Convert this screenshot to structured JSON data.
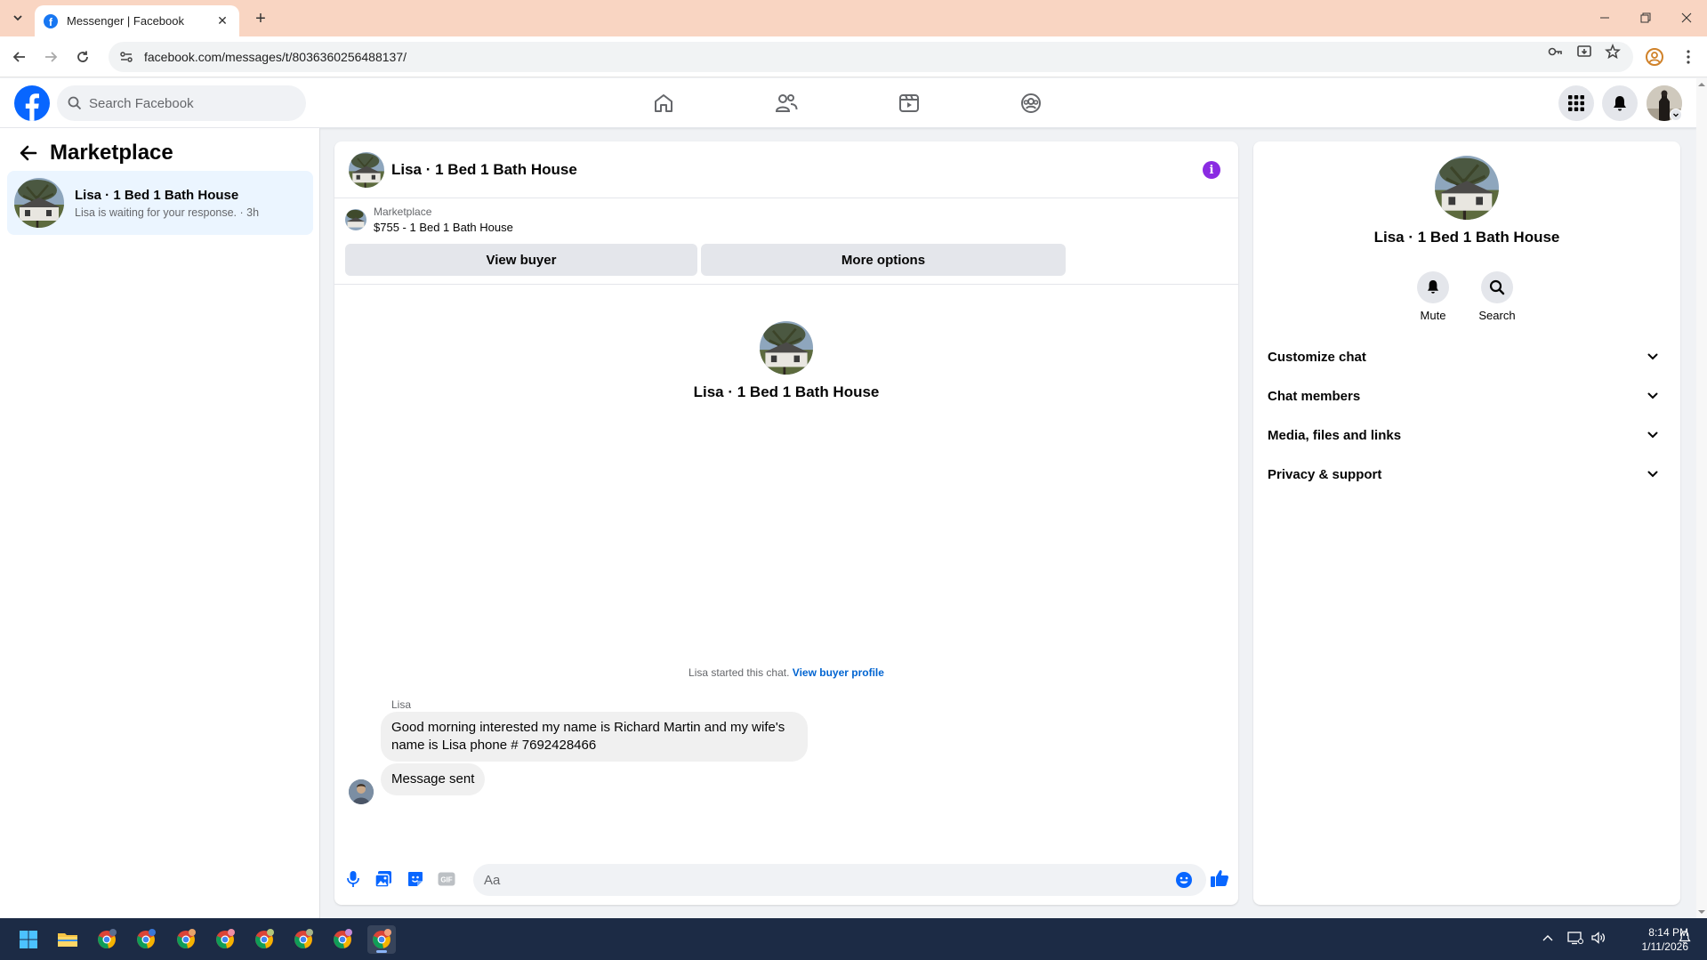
{
  "browser": {
    "tab_title": "Messenger | Facebook",
    "url": "facebook.com/messages/t/8036360256488137/"
  },
  "header": {
    "search_placeholder": "Search Facebook"
  },
  "left_panel": {
    "title": "Marketplace",
    "conversation": {
      "name": "Lisa · 1 Bed 1 Bath House",
      "preview": "Lisa is waiting for your response. · 3h"
    }
  },
  "chat": {
    "header_name": "Lisa · 1 Bed 1 Bath House",
    "marketplace_label": "Marketplace",
    "listing": "$755 - 1 Bed 1 Bath House",
    "view_buyer_label": "View buyer",
    "more_options_label": "More options",
    "profile_name": "Lisa · 1 Bed 1 Bath House",
    "started_text": "Lisa started this chat.",
    "view_buyer_profile_label": "View buyer profile",
    "sender_name": "Lisa",
    "messages": [
      {
        "text": "Good morning interested my name is Richard Martin and my wife's name is Lisa phone # 7692428466"
      },
      {
        "text": "Message sent"
      }
    ],
    "composer_placeholder": "Aa"
  },
  "info_panel": {
    "name": "Lisa · 1 Bed 1 Bath House",
    "actions": [
      {
        "label": "Mute"
      },
      {
        "label": "Search"
      }
    ],
    "sections": [
      {
        "label": "Customize chat"
      },
      {
        "label": "Chat members"
      },
      {
        "label": "Media, files and links"
      },
      {
        "label": "Privacy & support"
      }
    ]
  },
  "taskbar": {
    "time": "8:14 PM",
    "date": "1/11/2026"
  },
  "colors": {
    "facebook_blue": "#0866ff",
    "info_purple": "#8a2be2",
    "link_blue": "#0064d1",
    "selected_row": "#ebf5ff",
    "tab_strip": "#f9d5c2",
    "taskbar": "#1c2b45"
  }
}
